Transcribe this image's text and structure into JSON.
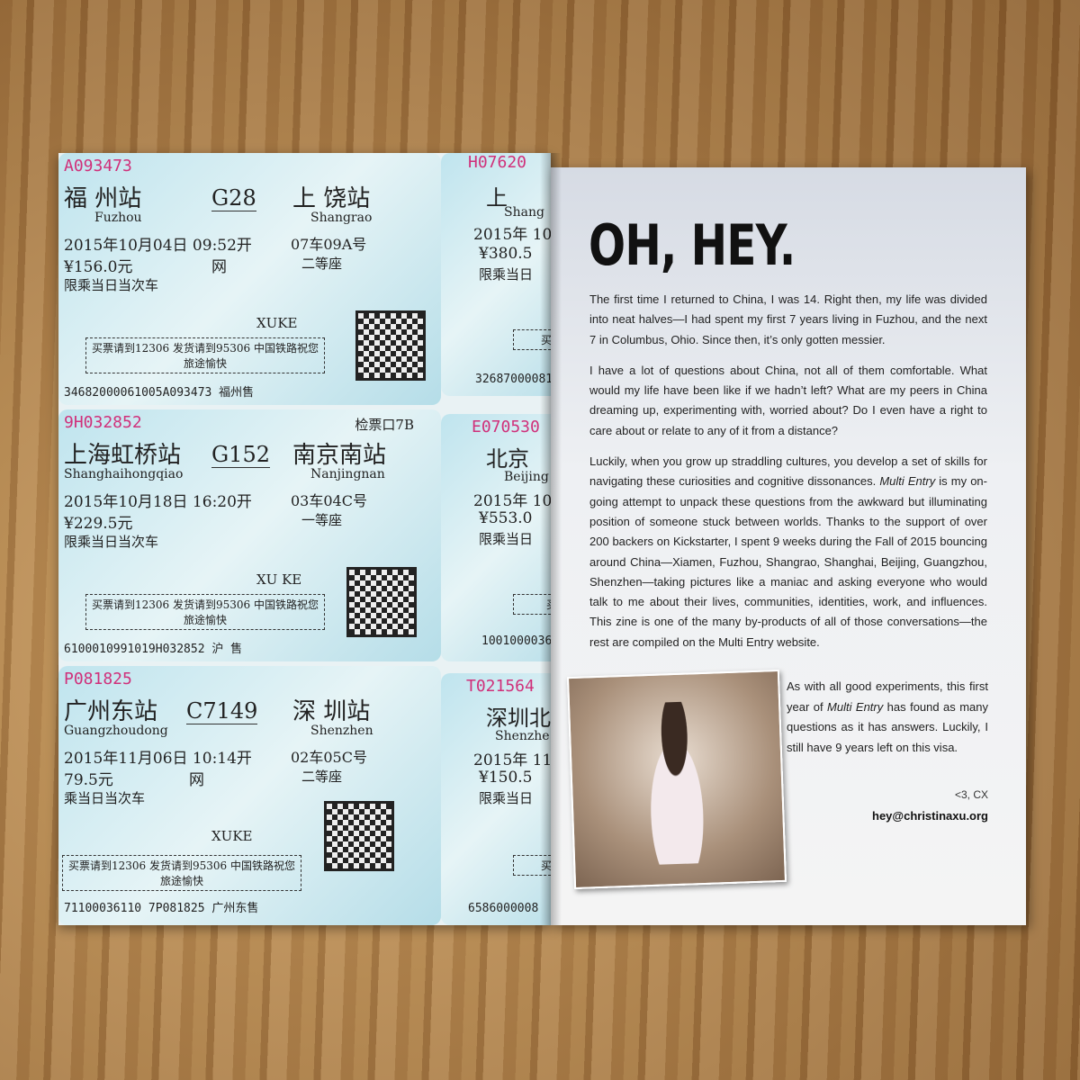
{
  "left_page": {
    "tickets": [
      {
        "no": "A093473",
        "from": "福 州站",
        "from_en": "Fuzhou",
        "train": "G28",
        "to": "上 饶站",
        "to_en": "Shangrao",
        "date": "2015年10月04日 09:52开",
        "seat": "07车09A号",
        "price": "¥156.0元",
        "class": "二等座",
        "sub": "网",
        "limit": "限乘当日当次车",
        "name": "XUKE",
        "notice": "买票请到12306 发货请到95306 中国铁路祝您旅途愉快",
        "serial": "34682000061005A093473 福州售",
        "gate": ""
      },
      {
        "no": "9H032852",
        "from": "上海虹桥站",
        "from_en": "Shanghaihongqiao",
        "train": "G152",
        "to": "南京南站",
        "to_en": "Nanjingnan",
        "date": "2015年10月18日 16:20开",
        "seat": "03车04C号",
        "price": "¥229.5元",
        "class": "一等座",
        "sub": "",
        "limit": "限乘当日当次车",
        "name": "XU KE",
        "notice": "买票请到12306 发货请到95306 中国铁路祝您旅途愉快",
        "serial": "6100010991019H032852 沪 售",
        "gate": "检票口7B"
      },
      {
        "no": "P081825",
        "from": "广州东站",
        "from_en": "Guangzhoudong",
        "train": "C7149",
        "to": "深 圳站",
        "to_en": "Shenzhen",
        "date": "2015年11月06日 10:14开",
        "seat": "02车05C号",
        "price": "79.5元",
        "class": "二等座",
        "sub": "网",
        "limit": "乘当日当次车",
        "name": "XUKE",
        "notice": "买票请到12306 发货请到95306 中国铁路祝您旅途愉快",
        "serial": "71100036110 7P081825 广州东售",
        "gate": ""
      },
      {
        "no": "H07620",
        "from": "上",
        "from_en": "Shang",
        "date": "2015年 10",
        "price": "¥380.5",
        "limit": "限乘当日",
        "notice": "买票",
        "serial": "32687000081"
      },
      {
        "no": "E070530",
        "from": "北京",
        "from_en": "Beijing",
        "date": "2015年 10",
        "price": "¥553.0",
        "limit": "限乘当日",
        "notice": "买",
        "serial": "1001000036"
      },
      {
        "no": "T021564",
        "from": "深圳北",
        "from_en": "Shenzhe",
        "date": "2015年 11",
        "price": "¥150.5",
        "limit": "限乘当日",
        "notice": "买票",
        "serial": "6586000008"
      }
    ]
  },
  "right_page": {
    "title": "OH, HEY.",
    "paragraphs": [
      "The first time I returned to China, I was 14. Right then, my life was divided into neat halves—I had spent my first 7 years living in Fuzhou, and the next 7 in Columbus, Ohio. Since then, it’s only gotten messier.",
      "I have a lot of questions about China, not all of them comfortable. What would my life have been like if we hadn’t left? What are my peers in China dreaming up, experimenting with, worried about? Do I even have a right to care about or relate to any of it from a distance?"
    ],
    "p3_a": "Luckily, when you grow up straddling cultures, you develop a set of skills for navigating these curiosities and cognitive dissonances. ",
    "p3_em": "Multi Entry",
    "p3_b": " is my on-going attempt to unpack these questions from the awkward but illuminating position of someone stuck between worlds. Thanks to the support of over 200 backers on Kickstarter, I spent 9 weeks during the Fall of 2015 bouncing around China—Xiamen, Fuzhou, Shangrao, Shanghai, Beijing, Guangzhou, Shenzhen—taking pictures like a maniac and asking everyone who would talk to me about their lives, communities, identities, work, and influences. This zine is one of the many by-products of all of those conversations—the rest are compiled on the Multi Entry website.",
    "closing_a": "As with all good experiments, this first year of ",
    "closing_em": "Multi Entry",
    "closing_b": " has found as many questions as it has answers. Luckily, I still have 9 years left on this visa.",
    "signoff": "<3, CX",
    "email": "hey@christinaxu.org"
  }
}
